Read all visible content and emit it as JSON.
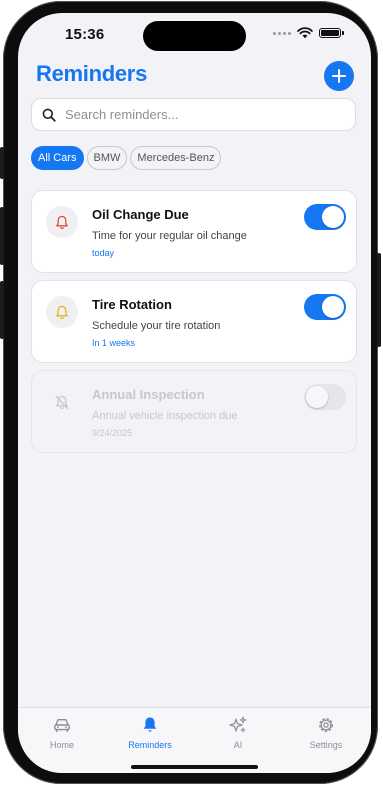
{
  "status_bar": {
    "time": "15:36"
  },
  "header": {
    "title": "Reminders"
  },
  "search": {
    "placeholder": "Search reminders..."
  },
  "filters": [
    {
      "label": "All Cars",
      "active": true
    },
    {
      "label": "BMW",
      "active": false
    },
    {
      "label": "Mercedes-Benz",
      "active": false
    }
  ],
  "reminders": [
    {
      "title": "Oil Change Due",
      "description": "Time for your regular oil change",
      "due": "today",
      "icon_color": "#e5483b",
      "enabled": true
    },
    {
      "title": "Tire Rotation",
      "description": "Schedule your tire rotation",
      "due": "In 1 weeks",
      "icon_color": "#e8b21a",
      "enabled": true
    },
    {
      "title": "Annual Inspection",
      "description": "Annual vehicle inspection due",
      "due": "9/24/2025",
      "icon_color": "#c7c7cc",
      "enabled": false
    }
  ],
  "tabs": [
    {
      "label": "Home",
      "icon": "car-icon",
      "active": false
    },
    {
      "label": "Reminders",
      "icon": "bell-icon",
      "active": true
    },
    {
      "label": "AI",
      "icon": "sparkles-icon",
      "active": false
    },
    {
      "label": "Settings",
      "icon": "gear-icon",
      "active": false
    }
  ],
  "colors": {
    "accent": "#1677f2",
    "background": "#f2f2f7"
  }
}
